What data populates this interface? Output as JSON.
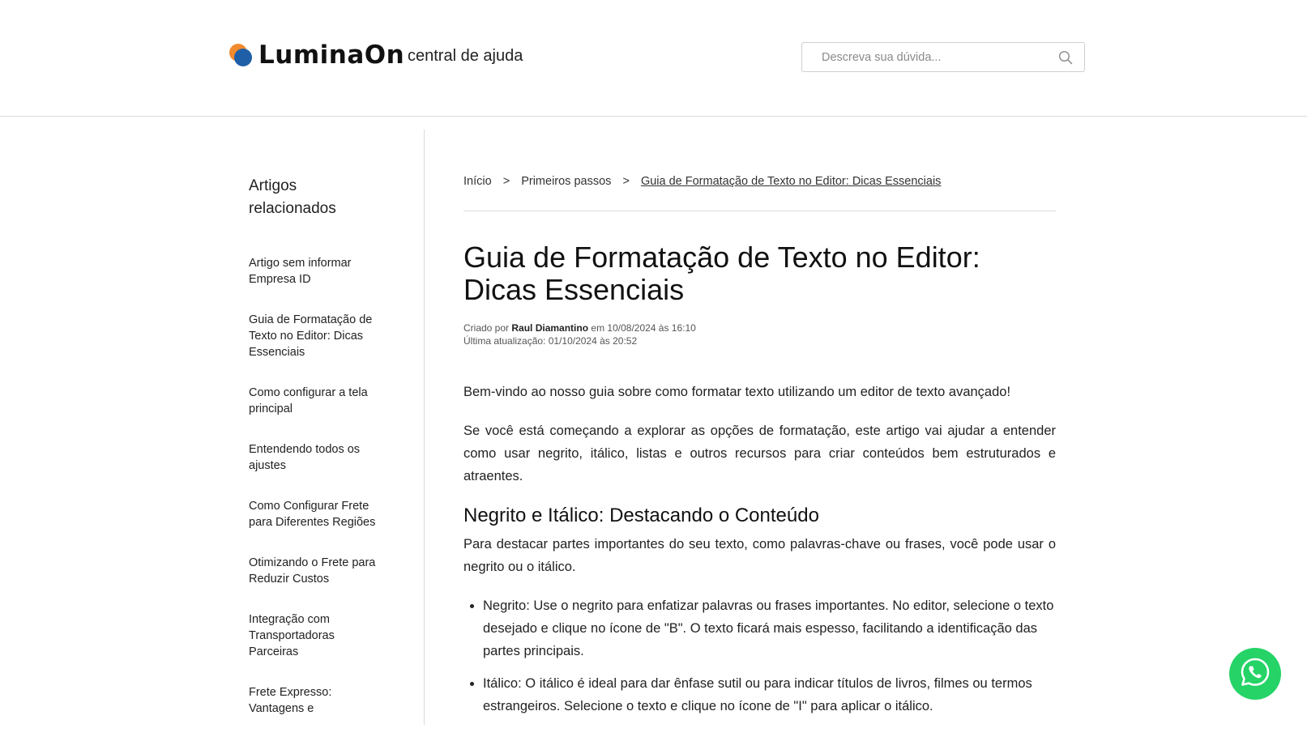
{
  "header": {
    "brand": "LuminaOn",
    "subtitle": "central de ajuda",
    "search_placeholder": "Descreva sua dúvida..."
  },
  "sidebar": {
    "title": "Artigos relacionados",
    "items": [
      {
        "label": "Artigo sem informar Empresa ID"
      },
      {
        "label": "Guia de Formatação de Texto no Editor: Dicas Essenciais"
      },
      {
        "label": "Como configurar a tela principal"
      },
      {
        "label": "Entendendo todos os ajustes"
      },
      {
        "label": "Como Configurar Frete para Diferentes Regiões"
      },
      {
        "label": "Otimizando o Frete para Reduzir Custos"
      },
      {
        "label": "Integração com Transportadoras Parceiras"
      },
      {
        "label": "Frete Expresso: Vantagens e"
      }
    ]
  },
  "breadcrumb": {
    "home": "Início",
    "separator": ">",
    "section": "Primeiros passos",
    "current": "Guia de Formatação de Texto no Editor: Dicas Essenciais"
  },
  "article": {
    "title": "Guia de Formatação de Texto no Editor: Dicas Essenciais",
    "created_prefix": "Criado por",
    "author": "Raul Diamantino",
    "created_suffix": "em 10/08/2024 às 16:10",
    "updated": "Última atualização: 01/10/2024 às 20:52",
    "intro": "Bem-vindo ao nosso guia sobre como formatar texto utilizando um editor de texto avançado!",
    "paragraph1": "Se você está começando a explorar as opções de formatação, este artigo vai ajudar a entender como usar negrito, itálico, listas e outros recursos para criar conteúdos bem estruturados e atraentes.",
    "heading1": "Negrito e Itálico: Destacando o Conteúdo",
    "paragraph2": "Para destacar partes importantes do seu texto, como palavras-chave ou frases, você pode usar o negrito ou o itálico.",
    "bullets": [
      "Negrito: Use o negrito para enfatizar palavras ou frases importantes. No editor, selecione o texto desejado e clique no ícone de \"B\". O texto ficará mais espesso, facilitando a identificação das partes principais.",
      "Itálico: O itálico é ideal para dar ênfase sutil ou para indicar títulos de livros, filmes ou termos estrangeiros. Selecione o texto e clique no ícone de \"I\" para aplicar o itálico."
    ]
  },
  "icons": {
    "search": "search-icon",
    "whatsapp": "whatsapp-icon"
  },
  "colors": {
    "whatsapp": "#25d366",
    "logo_orange": "#f28a2e",
    "logo_blue": "#1f5fa8"
  }
}
